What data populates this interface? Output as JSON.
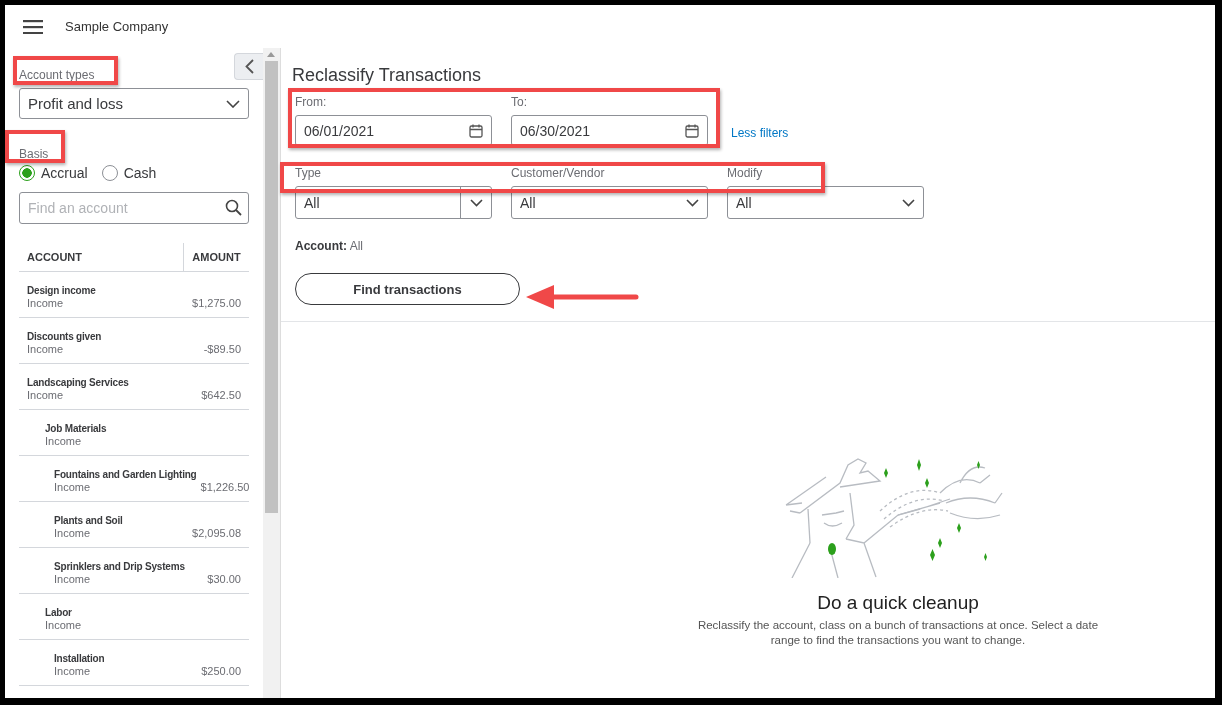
{
  "header": {
    "company": "Sample Company"
  },
  "sidebar": {
    "account_types_label": "Account types",
    "account_type": "Profit and loss",
    "basis_label": "Basis",
    "basis_options": [
      {
        "label": "Accrual",
        "selected": true
      },
      {
        "label": "Cash",
        "selected": false
      }
    ],
    "search": {
      "placeholder": "Find an account"
    },
    "table": {
      "columns": [
        "ACCOUNT",
        "AMOUNT"
      ],
      "rows": [
        {
          "name": "Design income",
          "type": "Income",
          "amount": "$1,275.00"
        },
        {
          "name": "Discounts given",
          "type": "Income",
          "amount": "-$89.50"
        },
        {
          "name": "Landscaping Services",
          "type": "Income",
          "amount": "$642.50",
          "children": [
            {
              "name": "Job Materials",
              "type": "Income",
              "children": [
                {
                  "name": "Fountains and Garden Lighting",
                  "type": "Income",
                  "amount": "$1,226.50"
                },
                {
                  "name": "Plants and Soil",
                  "type": "Income",
                  "amount": "$2,095.08"
                },
                {
                  "name": "Sprinklers and Drip Systems",
                  "type": "Income",
                  "amount": "$30.00"
                }
              ]
            },
            {
              "name": "Labor",
              "type": "Income",
              "children": [
                {
                  "name": "Installation",
                  "type": "Income",
                  "amount": "$250.00"
                }
              ]
            }
          ]
        }
      ]
    }
  },
  "main": {
    "title": "Reclassify Transactions",
    "dates": [
      {
        "label": "From:",
        "value": "06/01/2021"
      },
      {
        "label": "To:",
        "value": "06/30/2021"
      }
    ],
    "less_filters": "Less filters",
    "filters": [
      {
        "label": "Type",
        "value": "All"
      },
      {
        "label": "Customer/Vendor",
        "value": "All"
      },
      {
        "label": "Modify",
        "value": "All"
      }
    ],
    "account_label": "Account:",
    "account_value": "All",
    "find_button": "Find transactions",
    "empty_state": {
      "title": "Do a quick cleanup",
      "description": "Reclassify the account, class on a bunch of transactions at once. Select a date range to find the transactions you want to change."
    }
  }
}
